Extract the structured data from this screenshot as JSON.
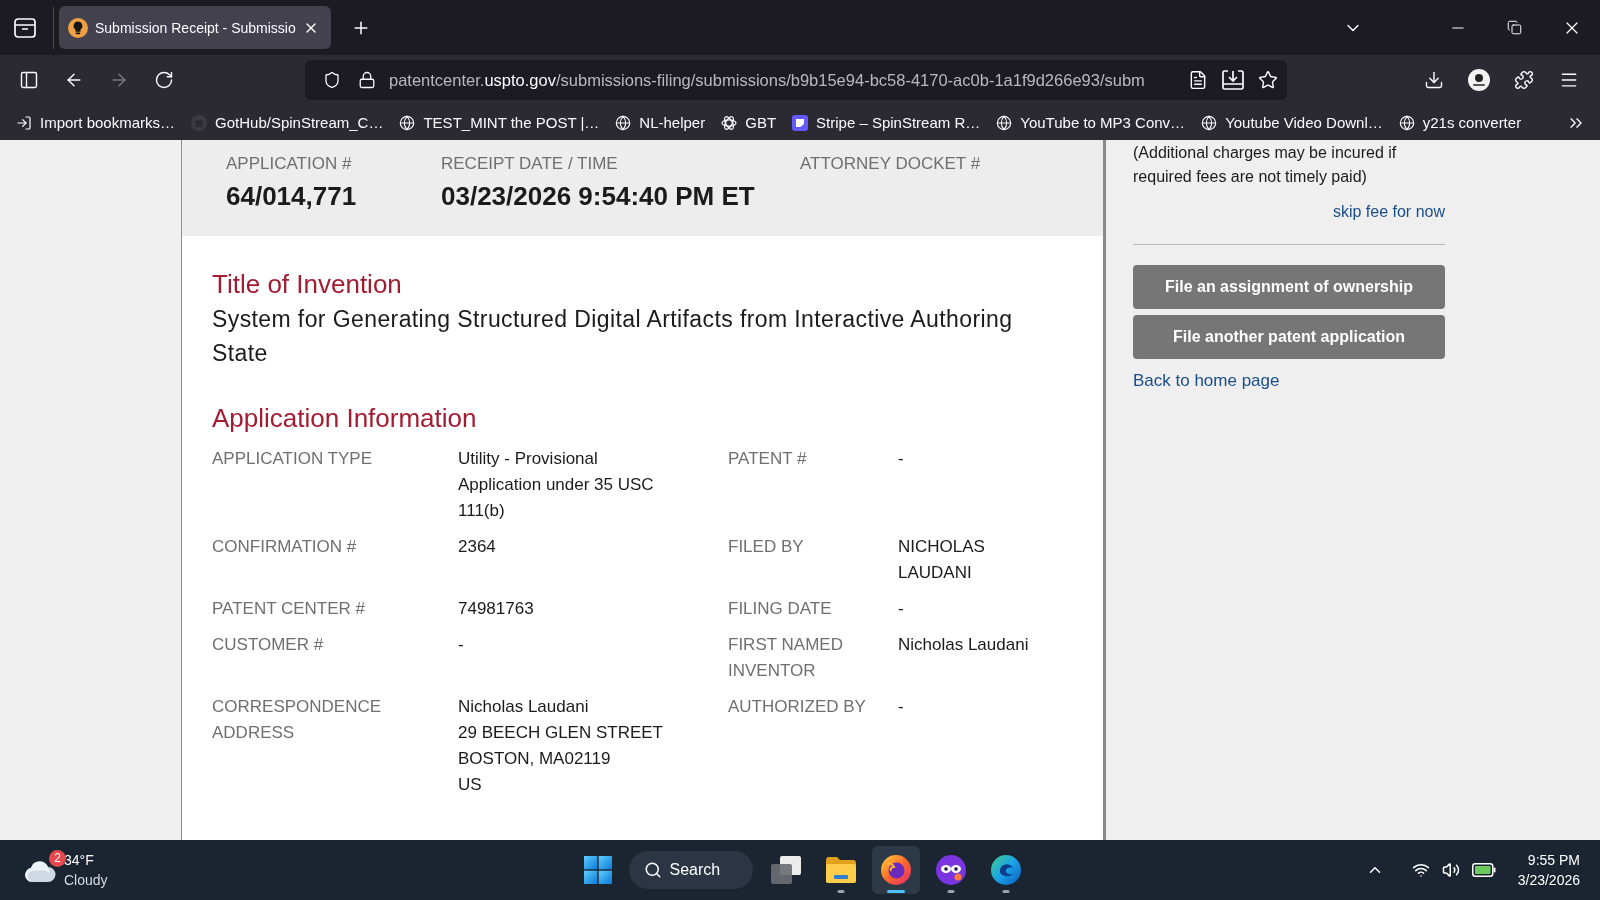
{
  "browser": {
    "tabs": [
      {
        "title": "Submission Receipt - Submissio",
        "selected": true
      }
    ],
    "navigation": [
      {
        "kind": "back",
        "disabled": false
      },
      {
        "kind": "forward",
        "disabled": true
      },
      {
        "kind": "reload",
        "disabled": false
      }
    ],
    "address": {
      "subdomain": "patentcenter.",
      "domain": "uspto.gov",
      "path": "/submissions-filing/submissions/b9b15e94-bc58-4170-ac0b-1a1f9d266e93/subm"
    },
    "bookmarks": [
      {
        "kind": "import",
        "label": "Import bookmarks…"
      },
      {
        "kind": "cat",
        "label": "GotHub/SpinStream_C…"
      },
      {
        "kind": "globe",
        "label": "TEST_MINT the POST |…"
      },
      {
        "kind": "globe",
        "label": "NL-helper"
      },
      {
        "kind": "knot",
        "label": "GBT"
      },
      {
        "kind": "tile",
        "label": "Stripe – SpinStream R…"
      },
      {
        "kind": "globe",
        "label": "YouTube to MP3 Conv…"
      },
      {
        "kind": "globe",
        "label": "Youtube Video Downl…"
      },
      {
        "kind": "globe",
        "label": "y21s converter"
      }
    ]
  },
  "receipt": {
    "summary": [
      {
        "label": "APPLICATION #",
        "value": "64/014,771"
      },
      {
        "label": "RECEIPT DATE / TIME",
        "value": "03/23/2026 9:54:40 PM ET"
      },
      {
        "label": "ATTORNEY DOCKET #"
      }
    ],
    "title_of_invention": {
      "heading": "Title of Invention",
      "text": "System for Generating Structured Digital Artifacts from Interactive Authoring State"
    },
    "application_information": {
      "heading": "Application Information",
      "rows": [
        [
          {
            "label": "APPLICATION TYPE",
            "value": [
              "Utility - Provisional Application under 35 USC 111(b)"
            ]
          },
          {
            "label": "PATENT #",
            "value": [
              "-"
            ]
          }
        ],
        [
          {
            "label": "CONFIRMATION #",
            "value": [
              "2364"
            ]
          },
          {
            "label": "FILED BY",
            "value": [
              "NICHOLAS LAUDANI"
            ]
          }
        ],
        [
          {
            "label": "PATENT CENTER #",
            "value": [
              "74981763"
            ]
          },
          {
            "label": "FILING DATE",
            "value": [
              "-"
            ]
          }
        ],
        [
          {
            "label": "CUSTOMER #",
            "value": [
              "-"
            ]
          },
          {
            "label": "FIRST NAMED INVENTOR",
            "value": [
              "Nicholas Laudani"
            ]
          }
        ],
        [
          {
            "label": "CORRESPONDENCE ADDRESS",
            "value": [
              "Nicholas Laudani",
              "29 BEECH GLEN STREET",
              "BOSTON, MA02119",
              "US"
            ]
          },
          {
            "label": "AUTHORIZED BY",
            "value": [
              "-"
            ]
          }
        ]
      ]
    }
  },
  "sidebar": {
    "note": "(Additional charges may be incured if required fees are not timely paid)",
    "skip_link": "skip fee for now",
    "buttons": [
      "File an assignment of ownership",
      "File another patent application"
    ],
    "home_link": "Back to home page"
  },
  "taskbar": {
    "weather": {
      "badge": "2",
      "temperature": "34°F",
      "condition": "Cloudy"
    },
    "search": "Search",
    "apps": [
      {
        "kind": "stack",
        "running": false,
        "selected": false
      },
      {
        "kind": "folder",
        "running": true,
        "selected": false
      },
      {
        "kind": "fox",
        "running": true,
        "selected": true
      },
      {
        "kind": "mask",
        "running": true,
        "selected": false
      },
      {
        "kind": "swirl",
        "running": true,
        "selected": false
      }
    ],
    "time": "9:55 PM",
    "date": "3/23/2026"
  }
}
